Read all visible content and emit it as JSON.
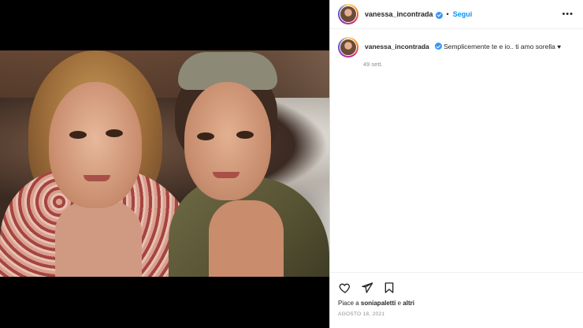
{
  "post": {
    "username": "vanessa_incontrada",
    "follow_label": "Segui",
    "dot": "•",
    "more_label": "•••",
    "caption_user": "vanessa_incontrada",
    "caption_text": "Semplicemente te e io.. ti amo sorella",
    "caption_emoji": "♥",
    "age": "49 sett.",
    "likes_prefix": "Piace a ",
    "likes_user": "soniapaletti",
    "likes_suffix": " e ",
    "likes_others": "altri",
    "date": "AGOSTO 18, 2021"
  },
  "icons": {
    "like": "heart-icon",
    "share": "paper-plane-icon",
    "save": "bookmark-icon",
    "verified": "verified-badge-icon"
  },
  "colors": {
    "follow": "#0095f6",
    "verified": "#3897f0",
    "secondary_text": "#8e8e8e"
  }
}
